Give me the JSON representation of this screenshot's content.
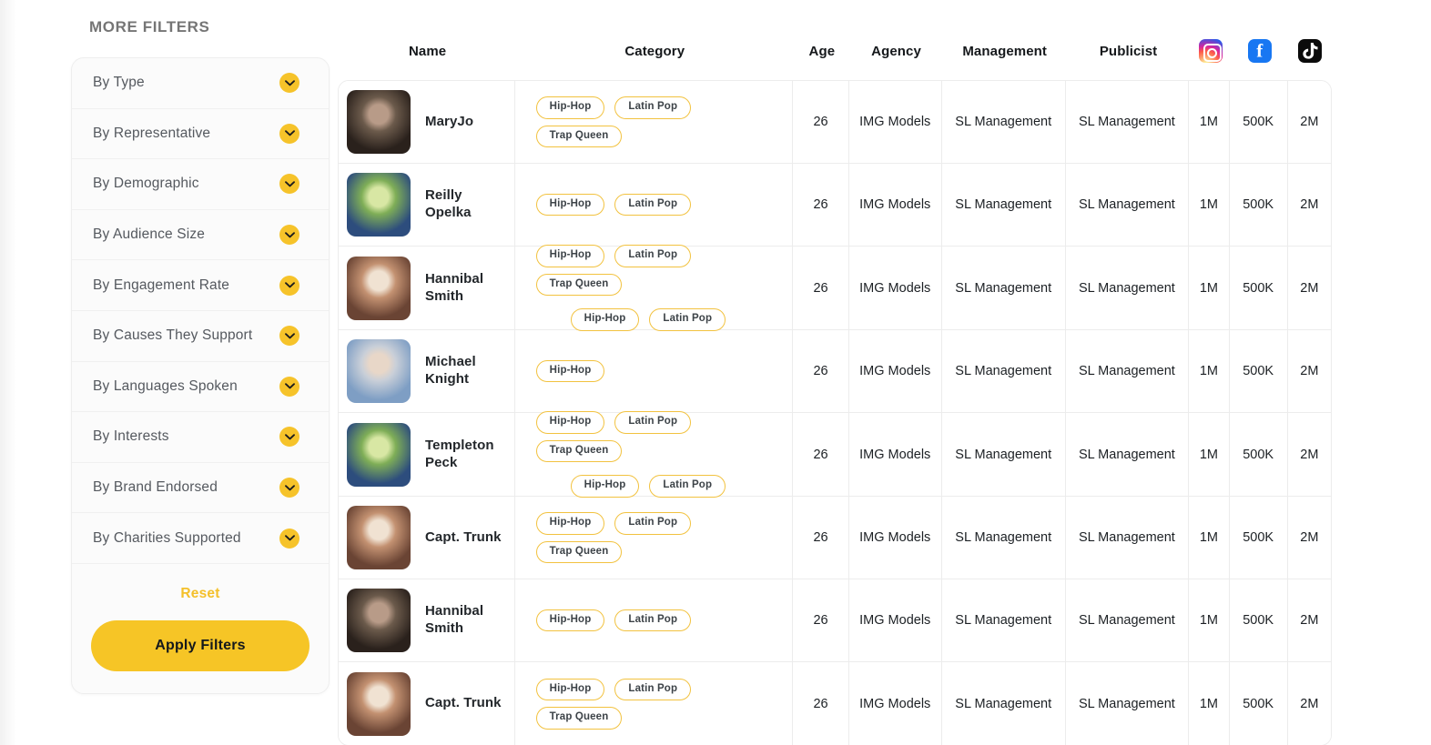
{
  "filters": {
    "heading": "MORE FILTERS",
    "items": [
      {
        "label": "By Type"
      },
      {
        "label": "By Representative"
      },
      {
        "label": "By Demographic"
      },
      {
        "label": "By Audience Size"
      },
      {
        "label": "By Engagement Rate"
      },
      {
        "label": "By Causes They Support"
      },
      {
        "label": "By Languages Spoken"
      },
      {
        "label": "By Interests"
      },
      {
        "label": "By Brand Endorsed"
      },
      {
        "label": "By Charities Supported"
      }
    ],
    "reset_label": "Reset",
    "apply_label": "Apply Filters",
    "accent_color": "#F6C526",
    "reset_color": "#F4C02A"
  },
  "table": {
    "columns": [
      {
        "key": "name",
        "label": "Name"
      },
      {
        "key": "category",
        "label": "Category"
      },
      {
        "key": "age",
        "label": "Age"
      },
      {
        "key": "agency",
        "label": "Agency"
      },
      {
        "key": "management",
        "label": "Management"
      },
      {
        "key": "publicist",
        "label": "Publicist"
      },
      {
        "key": "instagram",
        "label": "",
        "icon": "instagram-icon"
      },
      {
        "key": "facebook",
        "label": "",
        "icon": "facebook-icon"
      },
      {
        "key": "tiktok",
        "label": "",
        "icon": "tiktok-icon"
      }
    ],
    "rows": [
      {
        "name": "MaryJo",
        "avatar": "portrait-dark-gown-woman",
        "avatar_colors": [
          "#2a211c",
          "#6b5a4b",
          "#b89b88"
        ],
        "tags_line1": [
          "Hip-Hop",
          "Latin Pop",
          "Trap Queen"
        ],
        "tags_line2": [],
        "age": "26",
        "agency": "IMG Models",
        "management": "SL  Management",
        "publicist": "SL  Management",
        "instagram": "1M",
        "facebook": "500K",
        "tiktok": "2M"
      },
      {
        "name": "Reilly Opelka",
        "avatar": "portrait-bearded-athlete",
        "avatar_colors": [
          "#2d4d7d",
          "#7fae57",
          "#d8e7a4"
        ],
        "tags_line1": [
          "Hip-Hop",
          "Latin Pop"
        ],
        "tags_line2": [],
        "age": "26",
        "agency": "IMG Models",
        "management": "SL  Management",
        "publicist": "SL  Management",
        "instagram": "1M",
        "facebook": "500K",
        "tiktok": "2M"
      },
      {
        "name": "Hannibal Smith",
        "avatar": "portrait-blonde-smiling-woman",
        "avatar_colors": [
          "#6a4434",
          "#c39171",
          "#f0e2d2"
        ],
        "tags_line1": [
          "Hip-Hop",
          "Latin Pop",
          "Trap Queen"
        ],
        "tags_line2": [
          "Hip-Hop",
          "Latin Pop"
        ],
        "age": "26",
        "agency": "IMG Models",
        "management": "SL  Management",
        "publicist": "SL  Management",
        "instagram": "1M",
        "facebook": "500K",
        "tiktok": "2M"
      },
      {
        "name": "Michael Knight",
        "avatar": "portrait-blonde-carpet-woman",
        "avatar_colors": [
          "#7e9ec4",
          "#c9cfd8",
          "#e8d7c8"
        ],
        "tags_line1": [
          "Hip-Hop"
        ],
        "tags_line2": [],
        "age": "26",
        "agency": "IMG Models",
        "management": "SL  Management",
        "publicist": "SL  Management",
        "instagram": "1M",
        "facebook": "500K",
        "tiktok": "2M"
      },
      {
        "name": "Templeton Peck",
        "avatar": "portrait-bearded-athlete",
        "avatar_colors": [
          "#2d4d7d",
          "#7fae57",
          "#d8e7a4"
        ],
        "tags_line1": [
          "Hip-Hop",
          "Latin Pop",
          "Trap Queen"
        ],
        "tags_line2": [
          "Hip-Hop",
          "Latin Pop"
        ],
        "age": "26",
        "agency": "IMG Models",
        "management": "SL  Management",
        "publicist": "SL  Management",
        "instagram": "1M",
        "facebook": "500K",
        "tiktok": "2M"
      },
      {
        "name": "Capt. Trunk",
        "avatar": "portrait-blonde-smiling-woman",
        "avatar_colors": [
          "#6a4434",
          "#c39171",
          "#f0e2d2"
        ],
        "tags_line1": [
          "Hip-Hop",
          "Latin Pop",
          "Trap Queen"
        ],
        "tags_line2": [],
        "age": "26",
        "agency": "IMG Models",
        "management": "SL  Management",
        "publicist": "SL  Management",
        "instagram": "1M",
        "facebook": "500K",
        "tiktok": "2M"
      },
      {
        "name": "Hannibal Smith",
        "avatar": "portrait-dark-gown-woman",
        "avatar_colors": [
          "#2a211c",
          "#6b5a4b",
          "#b89b88"
        ],
        "tags_line1": [
          "Hip-Hop",
          "Latin Pop"
        ],
        "tags_line2": [],
        "age": "26",
        "agency": "IMG Models",
        "management": "SL  Management",
        "publicist": "SL  Management",
        "instagram": "1M",
        "facebook": "500K",
        "tiktok": "2M"
      },
      {
        "name": "Capt. Trunk",
        "avatar": "portrait-blonde-smiling-woman",
        "avatar_colors": [
          "#6a4434",
          "#c39171",
          "#f0e2d2"
        ],
        "tags_line1": [
          "Hip-Hop",
          "Latin Pop",
          "Trap Queen"
        ],
        "tags_line2": [],
        "age": "26",
        "agency": "IMG Models",
        "management": "SL  Management",
        "publicist": "SL  Management",
        "instagram": "1M",
        "facebook": "500K",
        "tiktok": "2M"
      }
    ]
  }
}
